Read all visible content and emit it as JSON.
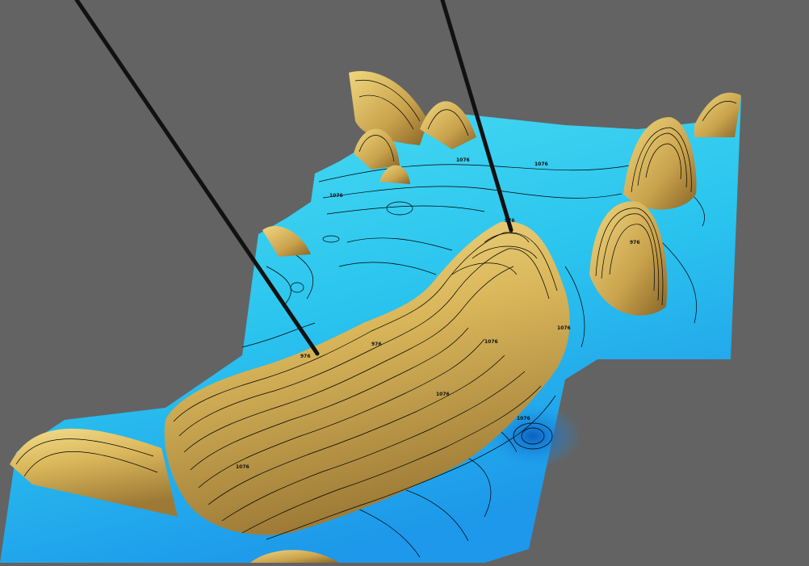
{
  "scene": {
    "background_color": "#636363",
    "surface_low_color": "#1a8fe8",
    "surface_mid_color": "#3fd8f0",
    "surface_high_color": "#d9b65a",
    "ridge_highlight_color": "#f1dc8a",
    "ridge_shadow_color": "#8c6a2c",
    "contour_line_color": "#000000",
    "well_color": "#111111",
    "contour_labels": [
      "976",
      "976",
      "976",
      "976",
      "1076",
      "1076",
      "1076",
      "1076",
      "1076",
      "1076",
      "1076",
      "1076"
    ]
  }
}
